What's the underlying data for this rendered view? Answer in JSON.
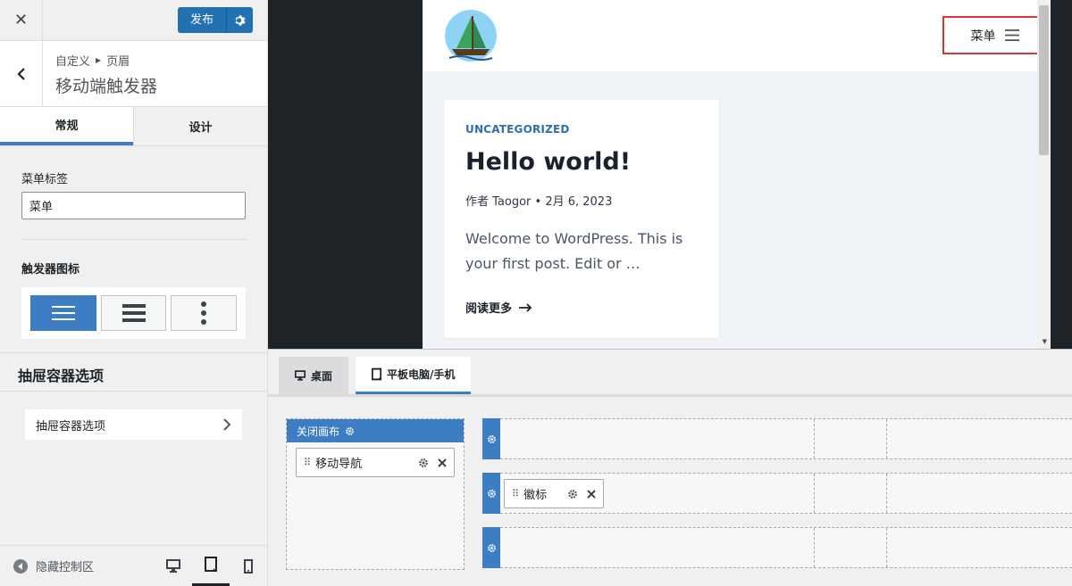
{
  "topbar": {
    "close_glyph": "✕",
    "publish_label": "发布"
  },
  "section": {
    "breadcrumb_parent": "自定义",
    "breadcrumb_current": "页眉",
    "title": "移动端触发器"
  },
  "tabs": [
    {
      "label": "常规",
      "active": true
    },
    {
      "label": "设计",
      "active": false
    }
  ],
  "menu_label_field": {
    "label": "菜单标签",
    "value": "菜单"
  },
  "trigger_icon": {
    "label": "触发器图标",
    "options": [
      "menu-icon",
      "menu-bold-icon",
      "menu-dots-icon"
    ],
    "selected_index": 0
  },
  "drawer": {
    "heading": "抽屉容器选项",
    "link_label": "抽屉容器选项"
  },
  "footer": {
    "hide_controls": "隐藏控制区",
    "devices": [
      "desktop-icon",
      "tablet-icon",
      "mobile-icon"
    ],
    "active_device_index": 1
  },
  "preview": {
    "menu_toggle_label": "菜单",
    "post": {
      "category": "UNCATEGORIZED",
      "title": "Hello world!",
      "meta": "作者 Taogor  •  2月 6, 2023",
      "excerpt": "Welcome to WordPress. This is your first post. Edit or …",
      "read_more": "阅读更多"
    }
  },
  "builder": {
    "tabs": [
      {
        "label": "桌面",
        "active": false
      },
      {
        "label": "平板电脑/手机",
        "active": true
      }
    ],
    "offcanvas_title": "关闭画布",
    "offcanvas_item": "移动导航",
    "row_item": "徽标"
  },
  "colors": {
    "accent": "#3c7dc4",
    "publish": "#2271b1",
    "highlight_border": "#d63638",
    "category_link": "#2f6fb0"
  }
}
